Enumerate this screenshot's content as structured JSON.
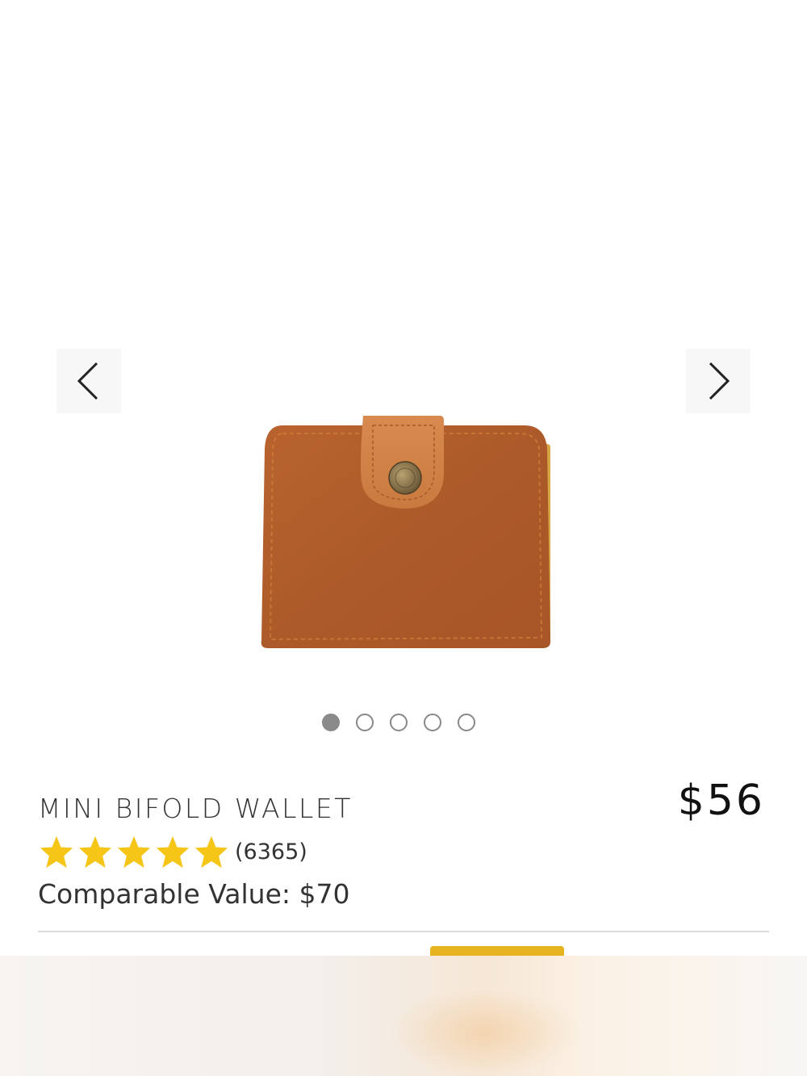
{
  "product": {
    "title": "MINI BIFOLD WALLET",
    "price": "$56",
    "review_count": "(6365)",
    "rating_stars": 5,
    "comparable_value": "Comparable Value: $70",
    "image_icon": "wallet-image"
  },
  "gallery": {
    "prev_icon": "chevron-left-icon",
    "next_icon": "chevron-right-icon",
    "slide_count": 5,
    "active_slide": 1
  },
  "colors": {
    "star": "#f5c518",
    "accent": "#e6b41f",
    "leather": "#b5622e",
    "dot_active": "#8a8a8a"
  }
}
